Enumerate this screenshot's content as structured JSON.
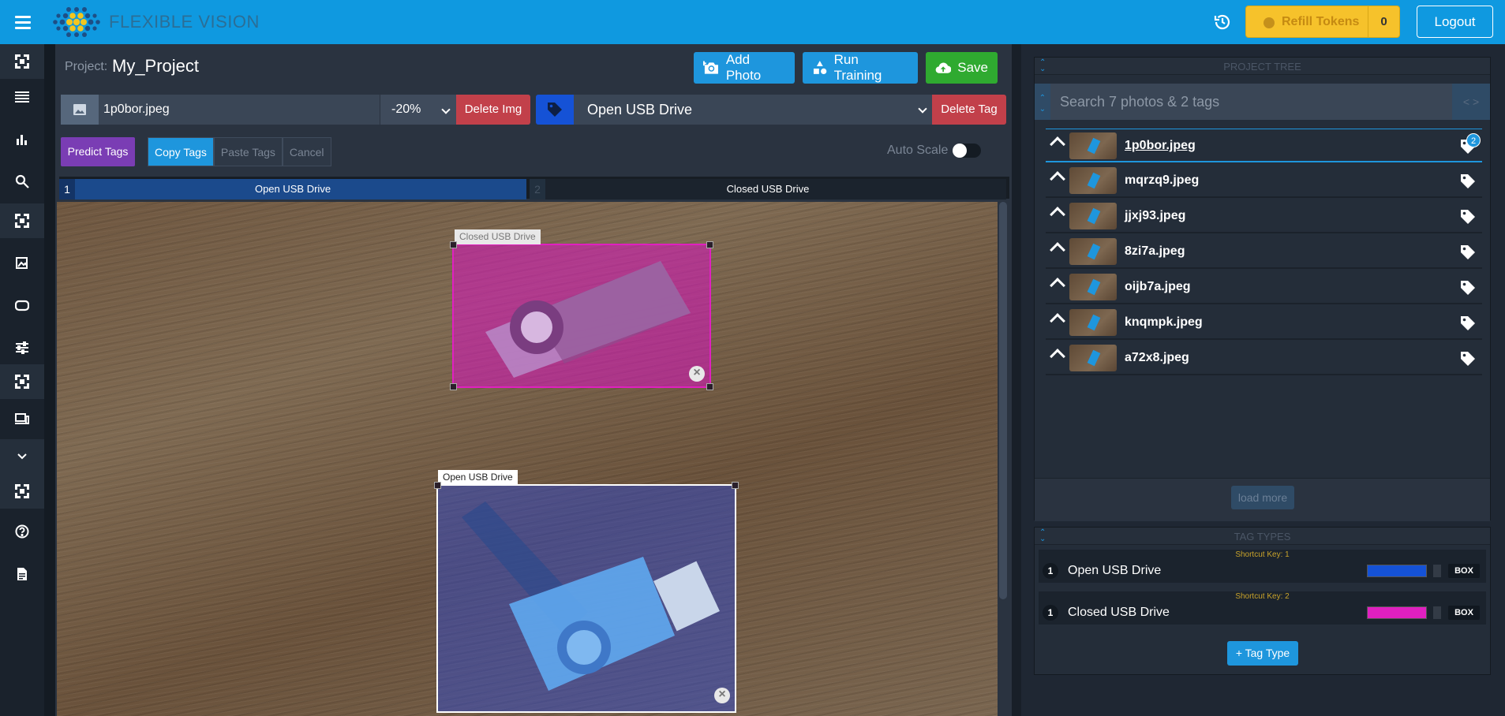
{
  "topbar": {
    "brand": "FLEXIBLE VISION",
    "refill_label": "Refill Tokens",
    "token_count": "0",
    "logout_label": "Logout"
  },
  "editor": {
    "project_label": "Project:",
    "project_name": "My_Project",
    "add_photo_label": "Add Photo",
    "run_training_label": "Run Training",
    "save_label": "Save",
    "image_name": "1p0bor.jpeg",
    "zoom_value": "-20%",
    "delete_img_label": "Delete Img",
    "selected_tag": "Open USB Drive",
    "delete_tag_label": "Delete Tag",
    "predict_tags_label": "Predict Tags",
    "copy_tags_label": "Copy Tags",
    "paste_tags_label": "Paste Tags",
    "cancel_label": "Cancel",
    "auto_scale_label": "Auto Scale",
    "auto_scale_on": false,
    "tag_tabs": [
      {
        "num": "1",
        "label": "Open USB Drive",
        "active": true
      },
      {
        "num": "2",
        "label": "Closed USB Drive",
        "active": false
      }
    ],
    "boxes": [
      {
        "label": "Closed USB Drive",
        "color": "#e020c0"
      },
      {
        "label": "Open USB Drive",
        "color": "#1552d6"
      }
    ]
  },
  "tree": {
    "title": "PROJECT TREE",
    "search_placeholder": "Search 7 photos & 2 tags",
    "items": [
      {
        "name": "1p0bor.jpeg",
        "tag_count": "2",
        "selected": true
      },
      {
        "name": "mqrzq9.jpeg",
        "tag_count": "",
        "selected": false
      },
      {
        "name": "jjxj93.jpeg",
        "tag_count": "",
        "selected": false
      },
      {
        "name": "8zi7a.jpeg",
        "tag_count": "",
        "selected": false
      },
      {
        "name": "oijb7a.jpeg",
        "tag_count": "",
        "selected": false
      },
      {
        "name": "knqmpk.jpeg",
        "tag_count": "",
        "selected": false
      },
      {
        "name": "a72x8.jpeg",
        "tag_count": "",
        "selected": false
      }
    ],
    "load_more_label": "load more"
  },
  "tag_types": {
    "title": "TAG TYPES",
    "items": [
      {
        "shortcut": "Shortcut Key: 1",
        "num": "1",
        "name": "Open USB Drive",
        "color": "#1552d6",
        "mode": "BOX"
      },
      {
        "shortcut": "Shortcut Key: 2",
        "num": "1",
        "name": "Closed USB Drive",
        "color": "#e020c0",
        "mode": "BOX"
      }
    ],
    "add_label": "+ Tag Type"
  },
  "icons": [
    "menu-icon",
    "logo-icon",
    "history-icon",
    "coin-icon",
    "camera-icon",
    "shapes-icon",
    "cloud-upload-icon",
    "image-icon",
    "tag-icon",
    "chevron-up-icon",
    "close-icon",
    "search-icon"
  ]
}
